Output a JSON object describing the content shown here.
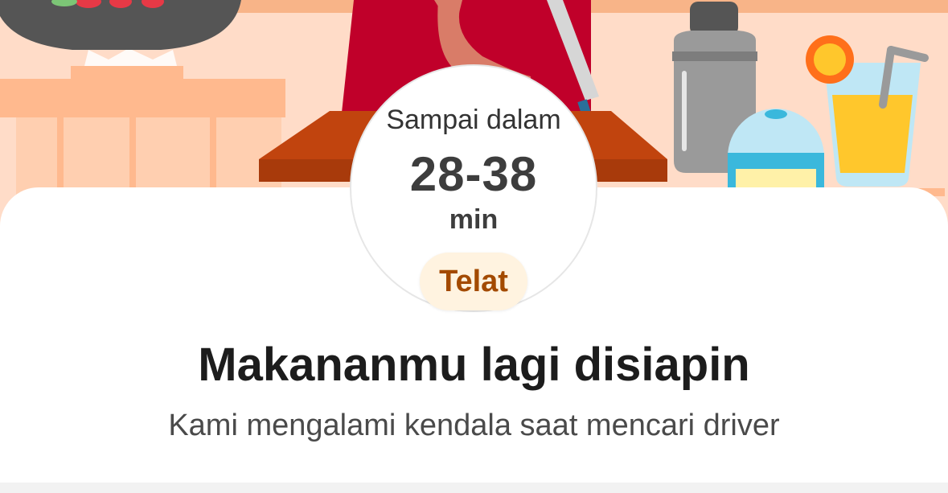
{
  "eta": {
    "label": "Sampai dalam",
    "range": "28-38",
    "unit": "min"
  },
  "status": {
    "badge_label": "Telat",
    "badge_color": "#a34a00",
    "badge_bg": "#fff3e0"
  },
  "message": {
    "title": "Makananmu lagi disiapin",
    "subtitle": "Kami mengalami kendala saat mencari driver"
  },
  "illustration": {
    "name": "chef-preparing-food",
    "background_color": "#ffdcc8"
  }
}
